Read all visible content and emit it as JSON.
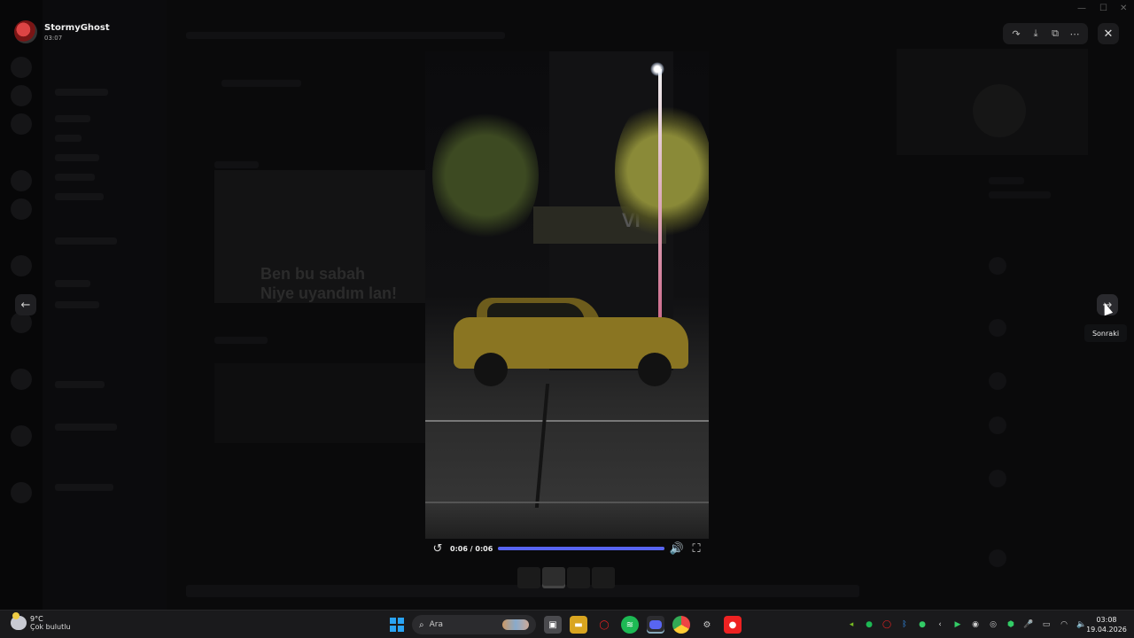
{
  "uploader": {
    "name": "StormyGhost",
    "time": "03:07"
  },
  "background": {
    "thumb_text_1": "Ben bu sabah",
    "thumb_text_2": "Niye uyandım lan!"
  },
  "video": {
    "time_label": "0:06 / 0:06",
    "progress": 1.0,
    "sign_text": "VI"
  },
  "tooltip": {
    "next": "Sonraki"
  },
  "icons": {
    "forward": "forward-icon",
    "download": "download-icon",
    "open_external": "open-external-icon",
    "more": "more-icon",
    "close": "close-icon",
    "prev": "arrow-left-icon",
    "next": "arrow-right-icon",
    "replay": "replay-icon",
    "volume": "volume-icon",
    "fullscreen": "fullscreen-icon"
  },
  "colors": {
    "accent": "#5865f2",
    "taskbar": "#1a1a1c"
  },
  "taskbar": {
    "weather_temp": "9°C",
    "weather_desc": "Çok bulutlu",
    "search_placeholder": "Ara",
    "clock_time": "03:08",
    "clock_date": "19.04.2026"
  }
}
